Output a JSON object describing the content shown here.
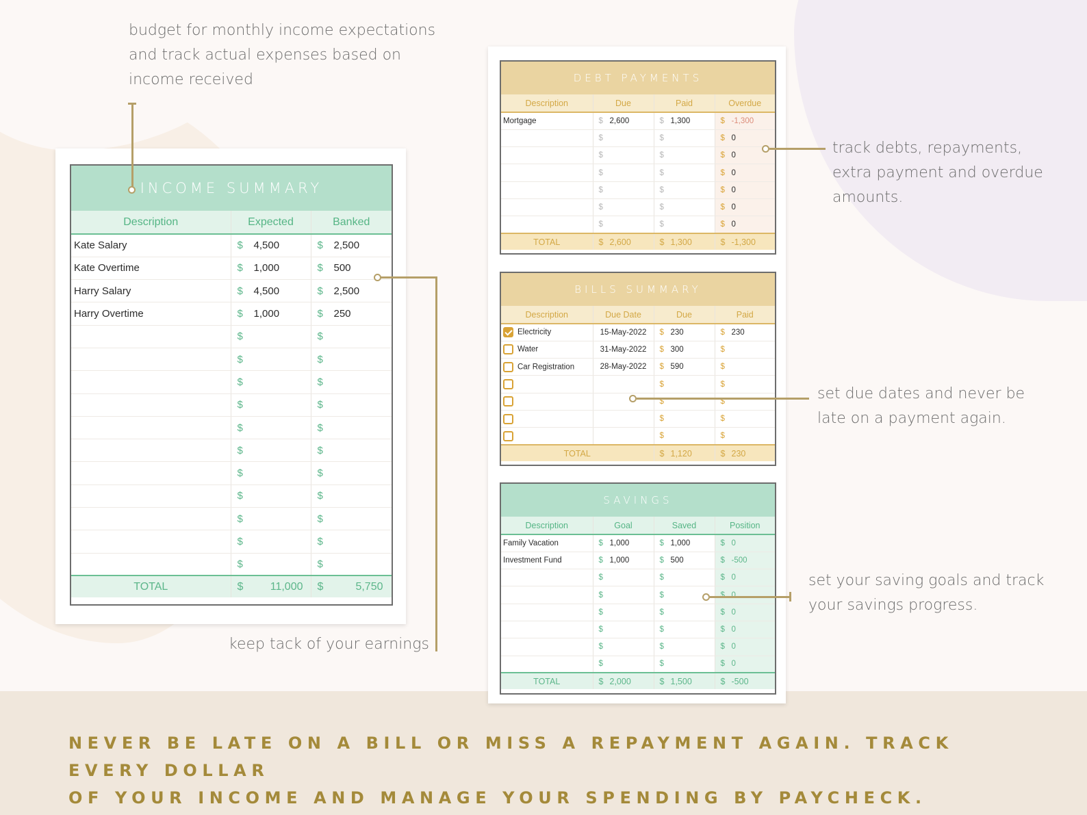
{
  "notes": {
    "income_top": [
      "budget for monthly income expectations",
      "and track actual expenses based on",
      "income received"
    ],
    "earnings": "keep tack of your earnings",
    "debts": [
      "track debts, repayments,",
      "extra payment and overdue",
      "amounts."
    ],
    "bills": [
      "set due dates and never be",
      "late on a payment again."
    ],
    "savings": [
      "set your saving goals and track",
      "your savings progress."
    ]
  },
  "tagline": [
    "NEVER BE LATE ON A BILL OR MISS A REPAYMENT AGAIN. TRACK EVERY DOLLAR",
    "OF YOUR INCOME AND MANAGE YOUR SPENDING BY PAYCHECK."
  ],
  "colors": {
    "green_accent": "#5cb68a",
    "gold_accent": "#d3a846",
    "connector": "#b59f68",
    "tagline": "#a48a3a"
  },
  "income": {
    "title": "INCOME SUMMARY",
    "headers": [
      "Description",
      "Expected",
      "Banked"
    ],
    "currency": "$",
    "rows": [
      {
        "desc": "Kate Salary",
        "expected": "4,500",
        "banked": "2,500"
      },
      {
        "desc": "Kate Overtime",
        "expected": "1,000",
        "banked": "500"
      },
      {
        "desc": "Harry Salary",
        "expected": "4,500",
        "banked": "2,500"
      },
      {
        "desc": "Harry Overtime",
        "expected": "1,000",
        "banked": "250"
      },
      {
        "desc": "",
        "expected": "",
        "banked": ""
      },
      {
        "desc": "",
        "expected": "",
        "banked": ""
      },
      {
        "desc": "",
        "expected": "",
        "banked": ""
      },
      {
        "desc": "",
        "expected": "",
        "banked": ""
      },
      {
        "desc": "",
        "expected": "",
        "banked": ""
      },
      {
        "desc": "",
        "expected": "",
        "banked": ""
      },
      {
        "desc": "",
        "expected": "",
        "banked": ""
      },
      {
        "desc": "",
        "expected": "",
        "banked": ""
      },
      {
        "desc": "",
        "expected": "",
        "banked": ""
      },
      {
        "desc": "",
        "expected": "",
        "banked": ""
      },
      {
        "desc": "",
        "expected": "",
        "banked": ""
      }
    ],
    "total": {
      "label": "TOTAL",
      "expected": "11,000",
      "banked": "5,750"
    }
  },
  "debt": {
    "title": "DEBT PAYMENTS",
    "headers": [
      "Description",
      "Due",
      "Paid",
      "Overdue"
    ],
    "currency": "$",
    "rows": [
      {
        "desc": "Mortgage",
        "due": "2,600",
        "paid": "1,300",
        "overdue": "-1,300",
        "negative": true
      },
      {
        "desc": "",
        "due": "",
        "paid": "",
        "overdue": "0"
      },
      {
        "desc": "",
        "due": "",
        "paid": "",
        "overdue": "0"
      },
      {
        "desc": "",
        "due": "",
        "paid": "",
        "overdue": "0"
      },
      {
        "desc": "",
        "due": "",
        "paid": "",
        "overdue": "0"
      },
      {
        "desc": "",
        "due": "",
        "paid": "",
        "overdue": "0"
      },
      {
        "desc": "",
        "due": "",
        "paid": "",
        "overdue": "0"
      }
    ],
    "total": {
      "label": "TOTAL",
      "due": "2,600",
      "paid": "1,300",
      "overdue": "-1,300"
    }
  },
  "bills": {
    "title": "BILLS SUMMARY",
    "headers": [
      "Description",
      "Due Date",
      "Due",
      "Paid"
    ],
    "currency": "$",
    "rows": [
      {
        "checked": true,
        "desc": "Electricity",
        "date": "15-May-2022",
        "due": "230",
        "paid": "230"
      },
      {
        "checked": false,
        "desc": "Water",
        "date": "31-May-2022",
        "due": "300",
        "paid": ""
      },
      {
        "checked": false,
        "desc": "Car Registration",
        "date": "28-May-2022",
        "due": "590",
        "paid": ""
      },
      {
        "checked": false,
        "desc": "",
        "date": "",
        "due": "",
        "paid": ""
      },
      {
        "checked": false,
        "desc": "",
        "date": "",
        "due": "",
        "paid": ""
      },
      {
        "checked": false,
        "desc": "",
        "date": "",
        "due": "",
        "paid": ""
      },
      {
        "checked": false,
        "desc": "",
        "date": "",
        "due": "",
        "paid": ""
      }
    ],
    "total": {
      "label": "TOTAL",
      "due": "1,120",
      "paid": "230"
    }
  },
  "savings": {
    "title": "SAVINGS",
    "headers": [
      "Description",
      "Goal",
      "Saved",
      "Position"
    ],
    "currency": "$",
    "rows": [
      {
        "desc": "Family Vacation",
        "goal": "1,000",
        "saved": "1,000",
        "position": "0"
      },
      {
        "desc": "Investment Fund",
        "goal": "1,000",
        "saved": "500",
        "position": "-500"
      },
      {
        "desc": "",
        "goal": "",
        "saved": "",
        "position": "0"
      },
      {
        "desc": "",
        "goal": "",
        "saved": "",
        "position": "0"
      },
      {
        "desc": "",
        "goal": "",
        "saved": "",
        "position": "0"
      },
      {
        "desc": "",
        "goal": "",
        "saved": "",
        "position": "0"
      },
      {
        "desc": "",
        "goal": "",
        "saved": "",
        "position": "0"
      },
      {
        "desc": "",
        "goal": "",
        "saved": "",
        "position": "0"
      }
    ],
    "total": {
      "label": "TOTAL",
      "goal": "2,000",
      "saved": "1,500",
      "position": "-500"
    }
  }
}
